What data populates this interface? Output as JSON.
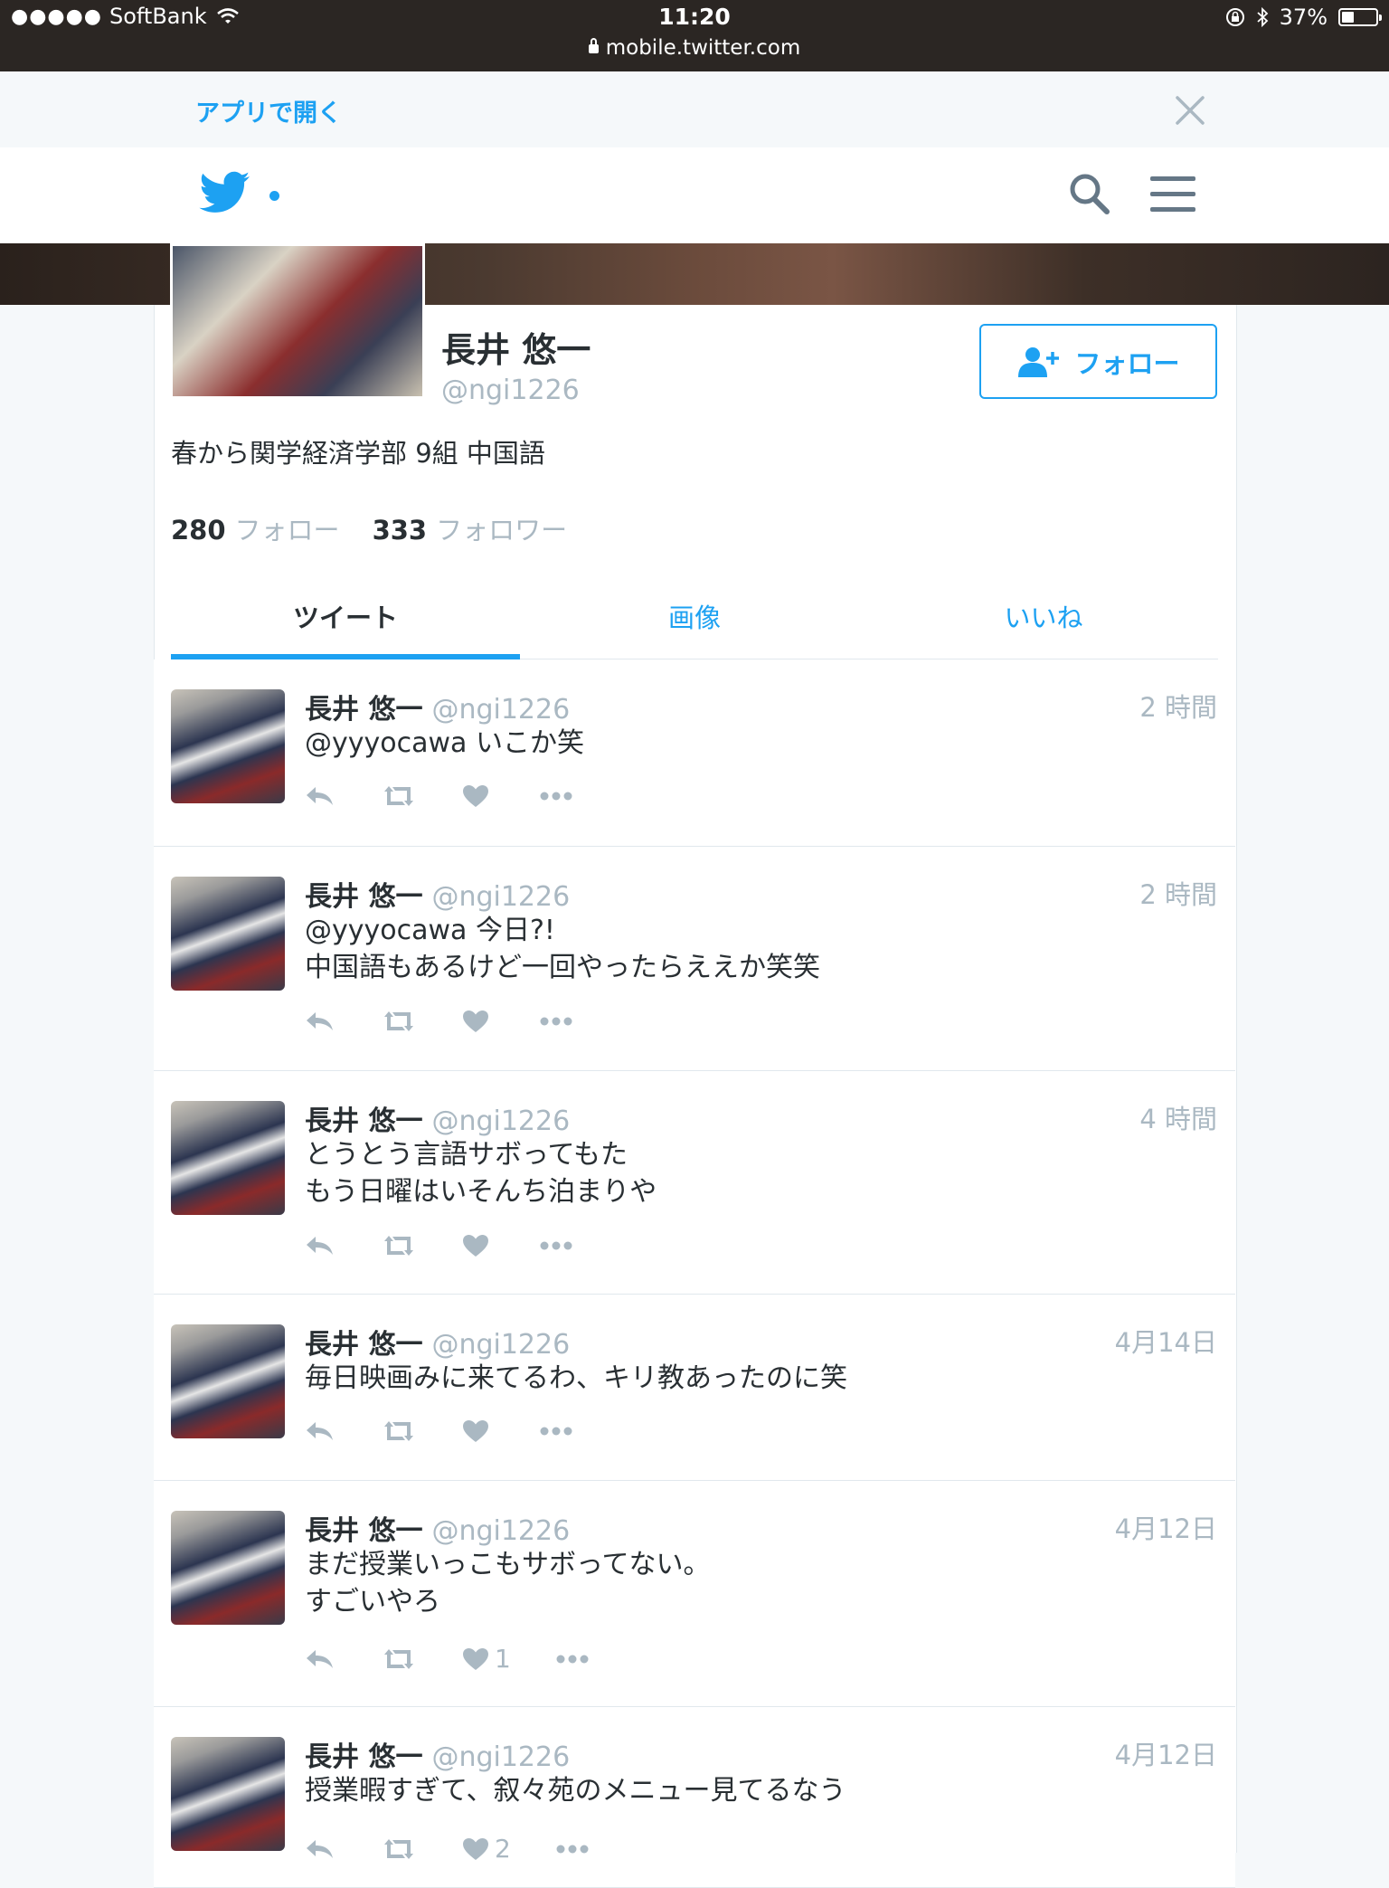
{
  "status_bar": {
    "signal_dots": "●●●●●",
    "carrier": "SoftBank",
    "time": "11:20",
    "url": "mobile.twitter.com",
    "battery": "37%",
    "battery_level": 0.37
  },
  "app_banner": {
    "open_in_app": "アプリで開く"
  },
  "profile": {
    "name": "長井 悠一",
    "handle": "@ngi1226",
    "follow_label": "フォロー",
    "bio": "春から関学経済学部 9組 中国語",
    "following_count": "280",
    "following_label": "フォロー",
    "followers_count": "333",
    "followers_label": "フォロワー"
  },
  "tabs": [
    {
      "label": "ツイート",
      "active": true
    },
    {
      "label": "画像",
      "active": false
    },
    {
      "label": "いいね",
      "active": false
    }
  ],
  "tweets": [
    {
      "name": "長井 悠一",
      "handle": "@ngi1226",
      "time": "2 時間",
      "text": "@yyyocawa いこか笑",
      "likes": ""
    },
    {
      "name": "長井 悠一",
      "handle": "@ngi1226",
      "time": "2 時間",
      "text": "@yyyocawa 今日?!\n中国語もあるけど一回やったらええか笑笑",
      "likes": ""
    },
    {
      "name": "長井 悠一",
      "handle": "@ngi1226",
      "time": "4 時間",
      "text": "とうとう言語サボってもた\nもう日曜はいそんち泊まりや",
      "likes": ""
    },
    {
      "name": "長井 悠一",
      "handle": "@ngi1226",
      "time": "4月14日",
      "text": "毎日映画みに来てるわ、キリ教あったのに笑",
      "likes": ""
    },
    {
      "name": "長井 悠一",
      "handle": "@ngi1226",
      "time": "4月12日",
      "text": "まだ授業いっこもサボってない。\nすごいやろ",
      "likes": "1"
    },
    {
      "name": "長井 悠一",
      "handle": "@ngi1226",
      "time": "4月12日",
      "text": "授業暇すぎて、叙々苑のメニュー見てるなう",
      "likes": "2"
    }
  ],
  "colors": {
    "accent": "#1da1f2",
    "text": "#292f33",
    "muted": "#aab8c2",
    "border": "#e1e8ed"
  }
}
